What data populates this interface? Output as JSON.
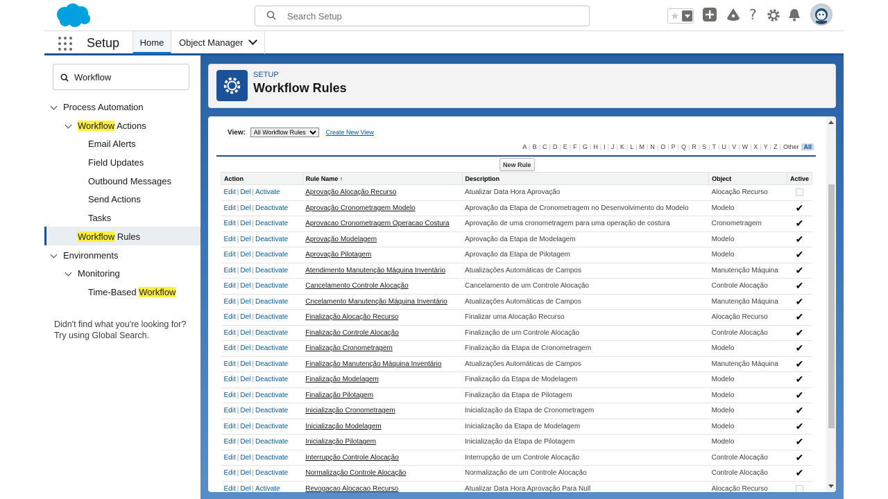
{
  "header": {
    "search_placeholder": "Search Setup"
  },
  "nav": {
    "app_name": "Setup",
    "tabs": [
      {
        "label": "Home"
      },
      {
        "label": "Object Manager"
      }
    ]
  },
  "sidebar": {
    "quickfind_value": "Workflow",
    "tree": {
      "process_automation": "Process Automation",
      "workflow_hl": "Workflow",
      "actions_rest": " Actions",
      "email_alerts": "Email Alerts",
      "field_updates": "Field Updates",
      "outbound_messages": "Outbound Messages",
      "send_actions": "Send Actions",
      "tasks": "Tasks",
      "workflow_rules_hl": "Workflow",
      "workflow_rules_rest": " Rules",
      "environments": "Environments",
      "monitoring": "Monitoring",
      "time_based_pre": "Time-Based ",
      "time_based_hl": "Workflow"
    },
    "not_found_line1": "Didn't find what you're looking for?",
    "not_found_line2": "Try using Global Search."
  },
  "page": {
    "breadcrumb": "SETUP",
    "title": "Workflow Rules"
  },
  "list": {
    "view_label": "View:",
    "view_selected": "All Workflow Rules",
    "create_view": "Create New View",
    "alphabet": [
      "A",
      "B",
      "C",
      "D",
      "E",
      "F",
      "G",
      "H",
      "I",
      "J",
      "K",
      "L",
      "M",
      "N",
      "O",
      "P",
      "Q",
      "R",
      "S",
      "T",
      "U",
      "V",
      "W",
      "X",
      "Y",
      "Z",
      "Other"
    ],
    "all_label": "All",
    "new_rule_button": "New Rule",
    "columns": {
      "action": "Action",
      "rule_name": "Rule Name",
      "sort_indicator": "↑",
      "description": "Description",
      "object": "Object",
      "active": "Active"
    },
    "action_edit": "Edit",
    "action_del": "Del",
    "rows": [
      {
        "toggle": "Activate",
        "name": "Aprovação Alocação Recurso",
        "description": "Atualizar Data Hora Aprovação",
        "object": "Alocação Recurso",
        "active": false
      },
      {
        "toggle": "Deactivate",
        "name": "Aprovação Cronometragem Modelo",
        "description": "Aprovação da Etapa de Cronometragem no Desenvolvimento do Modelo",
        "object": "Modelo",
        "active": true
      },
      {
        "toggle": "Deactivate",
        "name": "Aprovacao Cronometragem Operacao Costura",
        "description": "Aprovação de uma cronometragem para uma operação de costura",
        "object": "Cronometragem",
        "active": true
      },
      {
        "toggle": "Deactivate",
        "name": "Aprovação Modelagem",
        "description": "Aprovação da Etapa de Modelagem",
        "object": "Modelo",
        "active": true
      },
      {
        "toggle": "Deactivate",
        "name": "Aprovação Pilotagem",
        "description": "Aprovação da Etapa de Pilotagem",
        "object": "Modelo",
        "active": true
      },
      {
        "toggle": "Deactivate",
        "name": "Atendimento Manutenção Máquina Inventário",
        "description": "Atualizações Automáticas de Campos",
        "object": "Manutenção Máquina",
        "active": true
      },
      {
        "toggle": "Deactivate",
        "name": "Cancelamento Controle Alocação",
        "description": "Cancelamento de um Controle Alocação",
        "object": "Controle Alocação",
        "active": true
      },
      {
        "toggle": "Deactivate",
        "name": "Cncelamento Manutenção Máquina Inventário",
        "description": "Atualizações Automáticas de Campos",
        "object": "Manutenção Máquina",
        "active": true
      },
      {
        "toggle": "Deactivate",
        "name": "Finalização Alocação Recurso",
        "description": "Finalizar uma Alocação Recurso",
        "object": "Alocação Recurso",
        "active": true
      },
      {
        "toggle": "Deactivate",
        "name": "Finalização Controle Alocação",
        "description": "Finalização de um Controle Alocação",
        "object": "Controle Alocação",
        "active": true
      },
      {
        "toggle": "Deactivate",
        "name": "Finalização Cronometragem",
        "description": "Finalização da Etapa de Cronometragem",
        "object": "Modelo",
        "active": true
      },
      {
        "toggle": "Deactivate",
        "name": "Finalização Manutenção Máquina Inventário",
        "description": "Atualizações Automáticas de Campos",
        "object": "Manutenção Máquina",
        "active": true
      },
      {
        "toggle": "Deactivate",
        "name": "Finalização Modelagem",
        "description": "Finalização da Etapa de Modelagem",
        "object": "Modelo",
        "active": true
      },
      {
        "toggle": "Deactivate",
        "name": "Finalização Pilotagem",
        "description": "Finalização da Etapa de Pilotagem",
        "object": "Modelo",
        "active": true
      },
      {
        "toggle": "Deactivate",
        "name": "Inicialização Cronometragem",
        "description": "Inicialização da Etapa de Cronometragem",
        "object": "Modelo",
        "active": true
      },
      {
        "toggle": "Deactivate",
        "name": "Inicialização Modelagem",
        "description": "Inicialização da Etapa de Modelagem",
        "object": "Modelo",
        "active": true
      },
      {
        "toggle": "Deactivate",
        "name": "Inicialização Pilotagem",
        "description": "Inicialização da Etapa de Pilotagem",
        "object": "Modelo",
        "active": true
      },
      {
        "toggle": "Deactivate",
        "name": "Interrupção Controle Alocação",
        "description": "Interrupção de um Controle Alocação",
        "object": "Controle Alocação",
        "active": true
      },
      {
        "toggle": "Deactivate",
        "name": "Normalização Controle Alocação",
        "description": "Normalização de um Controle Alocação",
        "object": "Controle Alocação",
        "active": true
      },
      {
        "toggle": "Activate",
        "name": "Revogacao Alocacao Recurso",
        "description": "Atualizar Data Hora Aprovação Para Null",
        "object": "Alocação Recurso",
        "active": false
      }
    ]
  },
  "colors": {
    "brand_blue": "#1b5297",
    "link_blue": "#015ba7",
    "highlight": "#fff03f"
  }
}
